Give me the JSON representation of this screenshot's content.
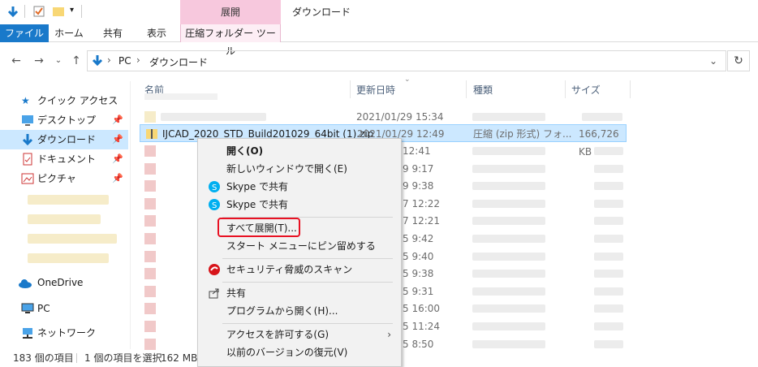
{
  "window": {
    "title": "ダウンロード"
  },
  "ribbon": {
    "context_tab_header": "展開",
    "tabs": [
      "ファイル",
      "ホーム",
      "共有",
      "表示",
      "圧縮フォルダー ツール"
    ]
  },
  "address": {
    "path": [
      "PC",
      "ダウンロード"
    ]
  },
  "columns": {
    "name": "名前",
    "date": "更新日時",
    "type": "種類",
    "size": "サイズ"
  },
  "nav": {
    "quick_access": "クイック アクセス",
    "items": [
      "デスクトップ",
      "ダウンロード",
      "ドキュメント",
      "ピクチャ"
    ],
    "onedrive": "OneDrive",
    "pc": "PC",
    "network": "ネットワーク"
  },
  "files": {
    "selected": {
      "name": "IJCAD_2020_STD_Build201029_64bit (1).zip",
      "date": "2021/01/29 12:49",
      "type": "圧縮 (zip 形式) フォ...",
      "size": "166,726 KB"
    },
    "first_date": "2021/01/29 15:34",
    "partial_dates": [
      "12:41",
      "9 9:17",
      "9 9:38",
      "7 12:22",
      "7 12:21",
      "5 9:42",
      "5 9:40",
      "5 9:38",
      "5 9:31",
      "5 16:00",
      "5 11:24",
      "5 8:50"
    ]
  },
  "context_menu": {
    "open": "開く(O)",
    "open_new_window": "新しいウィンドウで開く(E)",
    "skype_share_1": "Skype で共有",
    "skype_share_2": "Skype で共有",
    "extract_all": "すべて展開(T)...",
    "pin_start": "スタート メニューにピン留めする",
    "security_scan": "セキュリティ脅威のスキャン",
    "share": "共有",
    "open_with": "プログラムから開く(H)...",
    "give_access": "アクセスを許可する(G)",
    "restore_versions": "以前のバージョンの復元(V)"
  },
  "status": {
    "count": "183 個の項目",
    "selected": "1 個の項目を選択",
    "size": "162 MB"
  },
  "colors": {
    "accent": "#1979ca",
    "context_tab": "#f7c8dd",
    "selection": "#cce8ff",
    "highlight_box": "#e81123"
  }
}
